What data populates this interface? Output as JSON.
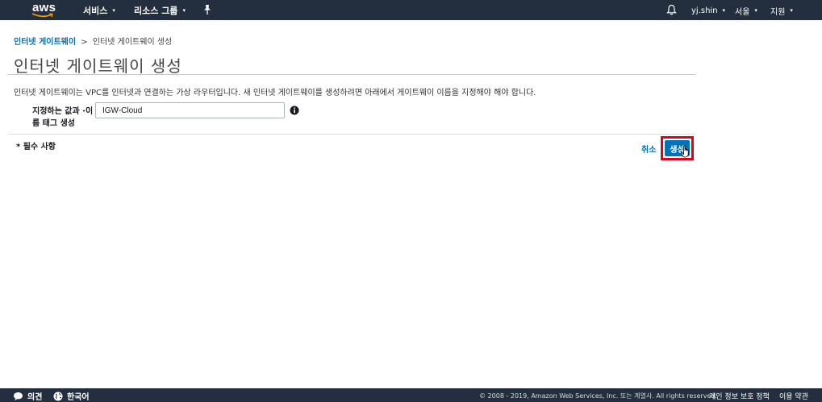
{
  "topbar": {
    "logo_text": "aws",
    "services_label": "서비스",
    "resource_groups_label": "리소스 그룹",
    "user_label": "yj.shin",
    "region_label": "서울",
    "support_label": "지원",
    "caret": "▾",
    "background": "#232f3e"
  },
  "breadcrumb": {
    "parent": "인터넷 게이트웨이",
    "separator": ">",
    "current": "인터넷 게이트웨이 생성"
  },
  "page": {
    "title": "인터넷 게이트웨이 생성",
    "description": "인터넷 게이트웨이는 VPC를 인터넷과 연결하는 가상 라우터입니다. 새 인터넷 게이트웨이를 생성하려면 아래에서 게이트웨이 이름을 지정해야 해야 합니다."
  },
  "form": {
    "name_label": "지정하는 값과 ·이름 태그 생성",
    "name_value": "IGW-Cloud",
    "required_note": "* 필수 사항",
    "cancel_label": "취소",
    "create_label": "생성"
  },
  "footer": {
    "feedback_label": "의견",
    "language_label": "한국어",
    "copyright": "© 2008 - 2019, Amazon Web Services, Inc. 또는 계열사. All rights reserved.",
    "privacy_label": "개인 정보 보호 정책",
    "terms_label": "이용 약관"
  },
  "colors": {
    "link": "#0073bb",
    "primary_button": "#0073bb",
    "highlight": "#e0001b",
    "aws_orange": "#ff9900"
  }
}
